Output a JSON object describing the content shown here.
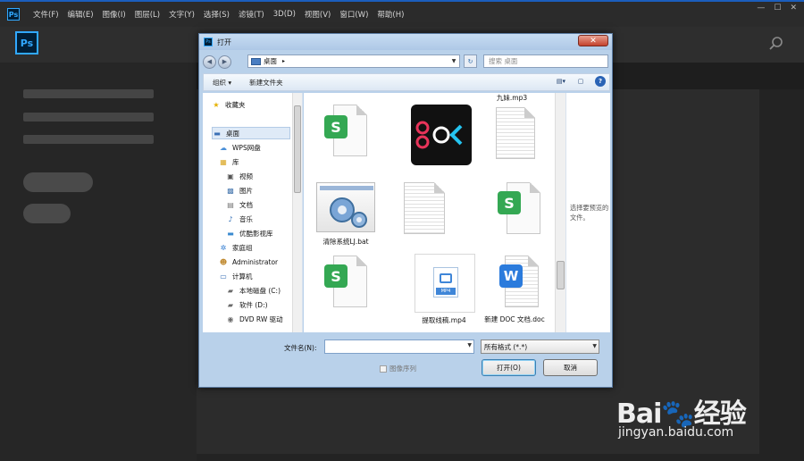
{
  "menubar": {
    "items": [
      "文件(F)",
      "编辑(E)",
      "图像(I)",
      "图层(L)",
      "文字(Y)",
      "选择(S)",
      "滤镜(T)",
      "3D(D)",
      "视图(V)",
      "窗口(W)",
      "帮助(H)"
    ],
    "win_controls": [
      "—",
      "☐",
      "✕"
    ]
  },
  "app": {
    "logo": "Ps"
  },
  "dialog": {
    "title": "打开",
    "close": "✕",
    "address": "桌面",
    "search_placeholder": "搜索 桌面",
    "toolbar": {
      "organize": "组织 ▾",
      "new_folder": "新建文件夹"
    },
    "nav": [
      {
        "label": "收藏夹",
        "icon": "star-icon"
      },
      {
        "label": "桌面",
        "icon": "desktop-icon"
      },
      {
        "label": "WPS网盘",
        "icon": "cloud-icon"
      },
      {
        "label": "库",
        "icon": "library-icon"
      },
      {
        "label": "视频",
        "icon": "video-icon"
      },
      {
        "label": "图片",
        "icon": "picture-icon"
      },
      {
        "label": "文档",
        "icon": "document-icon"
      },
      {
        "label": "音乐",
        "icon": "music-icon"
      },
      {
        "label": "优酷影视库",
        "icon": "folder-icon"
      },
      {
        "label": "家庭组",
        "icon": "homegroup-icon"
      },
      {
        "label": "Administrator",
        "icon": "user-icon"
      },
      {
        "label": "计算机",
        "icon": "computer-icon"
      },
      {
        "label": "本地磁盘 (C:)",
        "icon": "disk-icon"
      },
      {
        "label": "软件 (D:)",
        "icon": "disk-icon"
      },
      {
        "label": "DVD RW 驱动",
        "icon": "dvd-icon"
      }
    ],
    "files": [
      {
        "name": "九妹.mp3"
      },
      {
        "name": "清除系统LJ.bat"
      },
      {
        "name": "提取线稿.mp4"
      },
      {
        "name": "新建 DOC 文档.doc"
      }
    ],
    "preview_text": "选择要预览的文件。",
    "filename_label": "文件名(N):",
    "filename_value": "",
    "filter": "所有格式 (*.*)",
    "image_sequence": "图像序列",
    "open_button": "打开(O)",
    "cancel_button": "取消"
  },
  "watermark": {
    "logo_text": "Bai🐾经验",
    "url": "jingyan.baidu.com"
  }
}
